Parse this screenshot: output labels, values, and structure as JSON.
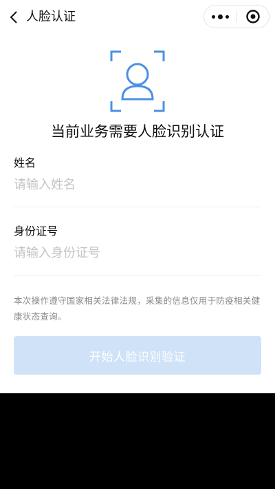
{
  "nav": {
    "title": "人脸认证",
    "back_icon": "chevron-left-icon",
    "capsule": {
      "more_icon": "more-dots-icon",
      "close_icon": "target-close-icon"
    }
  },
  "face": {
    "icon": "face-scan-icon",
    "accent_color": "#4a90e2"
  },
  "headline": "当前业务需要人脸识别认证",
  "form": {
    "name_label": "姓名",
    "name_placeholder": "请输入姓名",
    "id_label": "身份证号",
    "id_placeholder": "请输入身份证号"
  },
  "notice": "本次操作遵守国家相关法律法规，采集的信息仅用于防疫相关健康状态查询。",
  "button": {
    "label": "开始人脸识别验证",
    "background": "#cfe2f7",
    "text_color": "#ffffff"
  }
}
